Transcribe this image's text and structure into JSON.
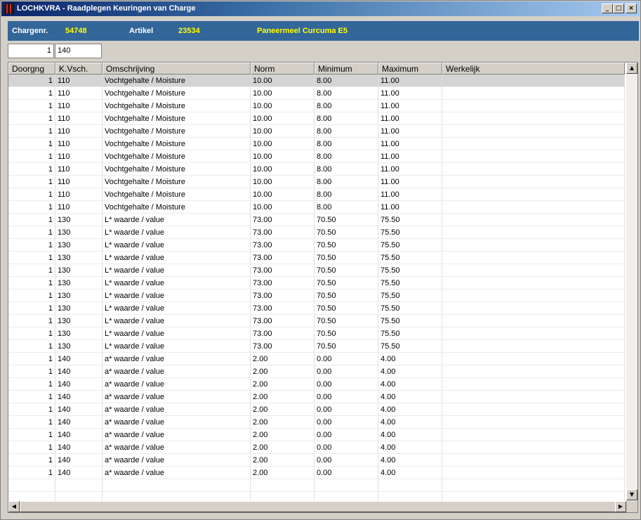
{
  "window": {
    "title": "LOCHKVRA - Raadplegen Keuringen van Charge",
    "controls": {
      "minimize": "_",
      "maximize": "□",
      "close": "×"
    }
  },
  "info": {
    "charge_label": "Chargenr.",
    "charge_value": "54748",
    "article_label": "Artikel",
    "article_value": "23534",
    "article_description": "Paneermeel Curcuma E5"
  },
  "filter": {
    "doorgang_value": "1",
    "kvsch_value": "140"
  },
  "grid": {
    "columns": [
      "Doorgng",
      "K.Vsch.",
      "Omschrijving",
      "Norm",
      "Minimum",
      "Maximum",
      "Werkelijk"
    ],
    "rows": [
      [
        "1",
        "110",
        "Vochtgehalte / Moisture",
        "10.00",
        "8.00",
        "11.00",
        ""
      ],
      [
        "1",
        "110",
        "Vochtgehalte / Moisture",
        "10.00",
        "8.00",
        "11.00",
        ""
      ],
      [
        "1",
        "110",
        "Vochtgehalte / Moisture",
        "10.00",
        "8.00",
        "11.00",
        ""
      ],
      [
        "1",
        "110",
        "Vochtgehalte / Moisture",
        "10.00",
        "8.00",
        "11.00",
        ""
      ],
      [
        "1",
        "110",
        "Vochtgehalte / Moisture",
        "10.00",
        "8.00",
        "11.00",
        ""
      ],
      [
        "1",
        "110",
        "Vochtgehalte / Moisture",
        "10.00",
        "8.00",
        "11.00",
        ""
      ],
      [
        "1",
        "110",
        "Vochtgehalte / Moisture",
        "10.00",
        "8.00",
        "11.00",
        ""
      ],
      [
        "1",
        "110",
        "Vochtgehalte / Moisture",
        "10.00",
        "8.00",
        "11.00",
        ""
      ],
      [
        "1",
        "110",
        "Vochtgehalte / Moisture",
        "10.00",
        "8.00",
        "11.00",
        ""
      ],
      [
        "1",
        "110",
        "Vochtgehalte / Moisture",
        "10.00",
        "8.00",
        "11.00",
        ""
      ],
      [
        "1",
        "110",
        "Vochtgehalte / Moisture",
        "10.00",
        "8.00",
        "11.00",
        ""
      ],
      [
        "1",
        "130",
        "L* waarde / value",
        "73.00",
        "70.50",
        "75.50",
        ""
      ],
      [
        "1",
        "130",
        "L* waarde / value",
        "73.00",
        "70.50",
        "75.50",
        ""
      ],
      [
        "1",
        "130",
        "L* waarde / value",
        "73.00",
        "70.50",
        "75.50",
        ""
      ],
      [
        "1",
        "130",
        "L* waarde / value",
        "73.00",
        "70.50",
        "75.50",
        ""
      ],
      [
        "1",
        "130",
        "L* waarde / value",
        "73.00",
        "70.50",
        "75.50",
        ""
      ],
      [
        "1",
        "130",
        "L* waarde / value",
        "73.00",
        "70.50",
        "75.50",
        ""
      ],
      [
        "1",
        "130",
        "L* waarde / value",
        "73.00",
        "70.50",
        "75.50",
        ""
      ],
      [
        "1",
        "130",
        "L* waarde / value",
        "73.00",
        "70.50",
        "75.50",
        ""
      ],
      [
        "1",
        "130",
        "L* waarde / value",
        "73.00",
        "70.50",
        "75.50",
        ""
      ],
      [
        "1",
        "130",
        "L* waarde / value",
        "73.00",
        "70.50",
        "75.50",
        ""
      ],
      [
        "1",
        "130",
        "L* waarde / value",
        "73.00",
        "70.50",
        "75.50",
        ""
      ],
      [
        "1",
        "140",
        "a* waarde / value",
        "2.00",
        "0.00",
        "4.00",
        ""
      ],
      [
        "1",
        "140",
        "a* waarde / value",
        "2.00",
        "0.00",
        "4.00",
        ""
      ],
      [
        "1",
        "140",
        "a* waarde / value",
        "2.00",
        "0.00",
        "4.00",
        ""
      ],
      [
        "1",
        "140",
        "a* waarde / value",
        "2.00",
        "0.00",
        "4.00",
        ""
      ],
      [
        "1",
        "140",
        "a* waarde / value",
        "2.00",
        "0.00",
        "4.00",
        ""
      ],
      [
        "1",
        "140",
        "a* waarde / value",
        "2.00",
        "0.00",
        "4.00",
        ""
      ],
      [
        "1",
        "140",
        "a* waarde / value",
        "2.00",
        "0.00",
        "4.00",
        ""
      ],
      [
        "1",
        "140",
        "a* waarde / value",
        "2.00",
        "0.00",
        "4.00",
        ""
      ],
      [
        "1",
        "140",
        "a* waarde / value",
        "2.00",
        "0.00",
        "4.00",
        ""
      ],
      [
        "1",
        "140",
        "a* waarde / value",
        "2.00",
        "0.00",
        "4.00",
        ""
      ]
    ],
    "selected_row": 0,
    "empty_rows": 2
  },
  "scrollbars": {
    "up_arrow": "▲",
    "down_arrow": "▼",
    "left_arrow": "◀",
    "right_arrow": "▶"
  }
}
